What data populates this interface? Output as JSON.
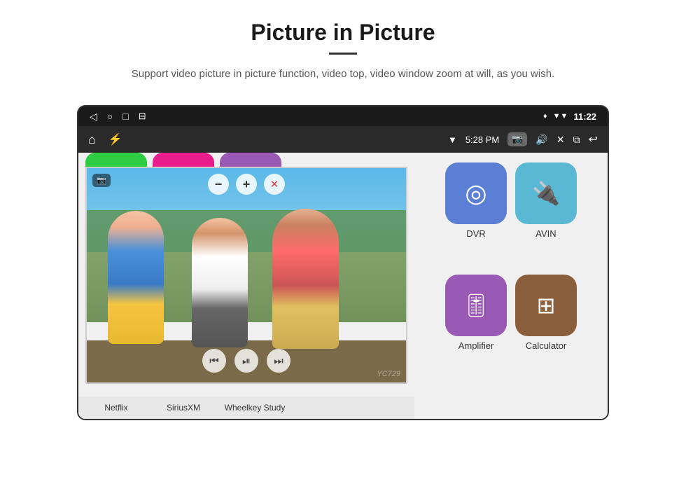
{
  "header": {
    "title": "Picture in Picture",
    "subtitle": "Support video picture in picture function, video top, video window zoom at will, as you wish."
  },
  "statusbar": {
    "back": "◁",
    "home": "○",
    "recent": "□",
    "menu": "⊟",
    "signal_icons": "♦ ▼",
    "time": "11:22"
  },
  "toolbar": {
    "home_icon": "⌂",
    "usb_icon": "⚡",
    "wifi": "▼",
    "time": "5:28 PM",
    "camera_icon": "📷",
    "volume_icon": "🔊",
    "close_icon": "✕",
    "window_icon": "⧉",
    "back_icon": "↩"
  },
  "pip": {
    "minus_label": "−",
    "plus_label": "+",
    "close_label": "✕",
    "prev_label": "⏮",
    "play_label": "⏯",
    "next_label": "⏭"
  },
  "apps": {
    "partial_row": [
      {
        "label": "Netflix",
        "color": "#2ecc40"
      },
      {
        "label": "SiriusXM",
        "color": "#e91e8c"
      },
      {
        "label": "Wheelkey Study",
        "color": "#9b59b6"
      }
    ],
    "full_row": [
      {
        "label": "DVR",
        "color": "#5b7fd4",
        "icon": "◎"
      },
      {
        "label": "AVIN",
        "color": "#5bb8d4",
        "icon": "🔌"
      }
    ],
    "second_row": [
      {
        "label": "Amplifier",
        "color": "#9b59b6",
        "icon": "🎚"
      },
      {
        "label": "Calculator",
        "color": "#8B5e3c",
        "icon": "⊞"
      }
    ]
  },
  "bottom_labels": {
    "netflix": "Netflix",
    "siriusxm": "SiriusXM",
    "wheelkey": "Wheelkey Study",
    "amplifier": "Amplifier",
    "calculator": "Calculator"
  },
  "watermark": "YC729"
}
